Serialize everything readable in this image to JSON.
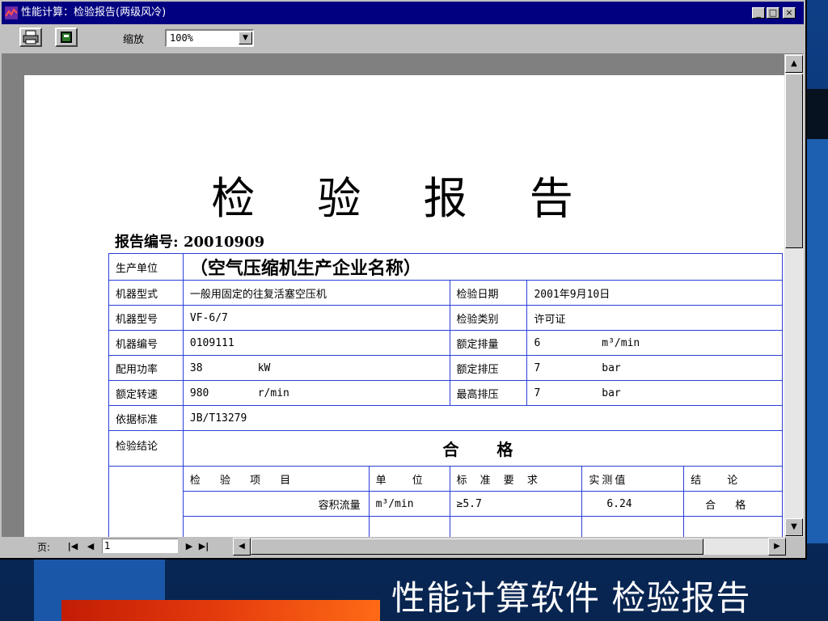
{
  "window": {
    "title": "性能计算：检验报告(两级风冷)",
    "controls": {
      "minimize": "_",
      "maximize": "□",
      "close": "×"
    }
  },
  "toolbar": {
    "zoom_label": "缩放",
    "zoom_value": "100%"
  },
  "statusbar": {
    "page_label": "页:",
    "page_number": "1"
  },
  "report": {
    "title": "检 验 报 告",
    "number_label": "报告编号:",
    "number": "20010909",
    "rows": {
      "producer_label": "生产单位",
      "producer_value": "（空气压缩机生产企业名称）",
      "type_label": "机器型式",
      "type_value": "一般用固定的往复活塞空压机",
      "date_label": "检验日期",
      "date_value": "2001年9月10日",
      "model_label": "机器型号",
      "model_value": "VF-6/7",
      "category_label": "检验类别",
      "category_value": "许可证",
      "serial_label": "机器编号",
      "serial_value": "0109111",
      "rated_flow_label": "额定排量",
      "rated_flow_value": "6",
      "rated_flow_unit": "m³/min",
      "power_label": "配用功率",
      "power_value": "38",
      "power_unit": "kW",
      "rated_pressure_label": "额定排压",
      "rated_pressure_value": "7",
      "rated_pressure_unit": "bar",
      "speed_label": "额定转速",
      "speed_value": "980",
      "speed_unit": "r/min",
      "max_pressure_label": "最高排压",
      "max_pressure_value": "7",
      "max_pressure_unit": "bar",
      "standard_label": "依据标准",
      "standard_value": "JB/T13279",
      "conclusion_label": "检验结论",
      "conclusion_value": "合 格"
    },
    "items_header": {
      "item": "检 验 项 目",
      "unit": "单 位",
      "requirement": "标 准 要 求",
      "measured": "实测值",
      "result": "结 论"
    },
    "items": [
      {
        "item": "容积流量",
        "unit": "m³/min",
        "requirement": "≥5.7",
        "measured": "6.24",
        "result": "合 格"
      }
    ]
  },
  "slide": {
    "caption": "性能计算软件 检验报告"
  }
}
